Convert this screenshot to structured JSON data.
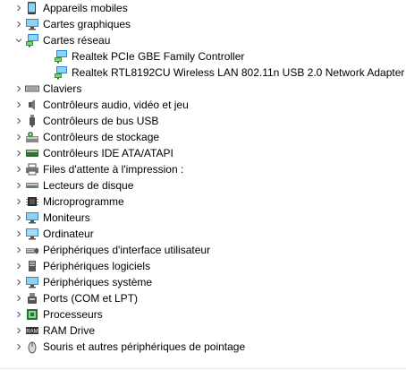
{
  "tree": [
    {
      "label": "Appareils mobiles",
      "icon": "mobile-device-icon",
      "expander": "collapsed"
    },
    {
      "label": "Cartes graphiques",
      "icon": "display-adapter-icon",
      "expander": "collapsed"
    },
    {
      "label": "Cartes réseau",
      "icon": "network-adapter-icon",
      "expander": "expanded"
    },
    {
      "label": "Realtek PCIe GBE Family Controller",
      "icon": "network-adapter-icon",
      "expander": "none"
    },
    {
      "label": "Realtek RTL8192CU Wireless LAN 802.11n USB 2.0 Network Adapter",
      "icon": "network-adapter-icon",
      "expander": "none"
    },
    {
      "label": "Claviers",
      "icon": "keyboard-icon",
      "expander": "collapsed"
    },
    {
      "label": "Contrôleurs audio, vidéo et jeu",
      "icon": "speaker-icon",
      "expander": "collapsed"
    },
    {
      "label": "Contrôleurs de bus USB",
      "icon": "usb-icon",
      "expander": "collapsed"
    },
    {
      "label": "Contrôleurs de stockage",
      "icon": "storage-controller-icon",
      "expander": "collapsed"
    },
    {
      "label": "Contrôleurs IDE ATA/ATAPI",
      "icon": "ide-controller-icon",
      "expander": "collapsed"
    },
    {
      "label": "Files d'attente à l'impression :",
      "icon": "printer-icon",
      "expander": "collapsed"
    },
    {
      "label": "Lecteurs de disque",
      "icon": "disk-drive-icon",
      "expander": "collapsed"
    },
    {
      "label": "Microprogramme",
      "icon": "firmware-icon",
      "expander": "collapsed"
    },
    {
      "label": "Moniteurs",
      "icon": "monitor-icon",
      "expander": "collapsed"
    },
    {
      "label": "Ordinateur",
      "icon": "computer-icon",
      "expander": "collapsed"
    },
    {
      "label": "Périphériques d'interface utilisateur",
      "icon": "hid-icon",
      "expander": "collapsed"
    },
    {
      "label": "Périphériques logiciels",
      "icon": "software-device-icon",
      "expander": "collapsed"
    },
    {
      "label": "Périphériques système",
      "icon": "system-device-icon",
      "expander": "collapsed"
    },
    {
      "label": "Ports (COM et LPT)",
      "icon": "port-icon",
      "expander": "collapsed"
    },
    {
      "label": "Processeurs",
      "icon": "processor-icon",
      "expander": "collapsed"
    },
    {
      "label": "RAM Drive",
      "icon": "ram-drive-icon",
      "expander": "collapsed"
    },
    {
      "label": "Souris et autres périphériques de pointage",
      "icon": "mouse-icon",
      "expander": "collapsed"
    }
  ]
}
